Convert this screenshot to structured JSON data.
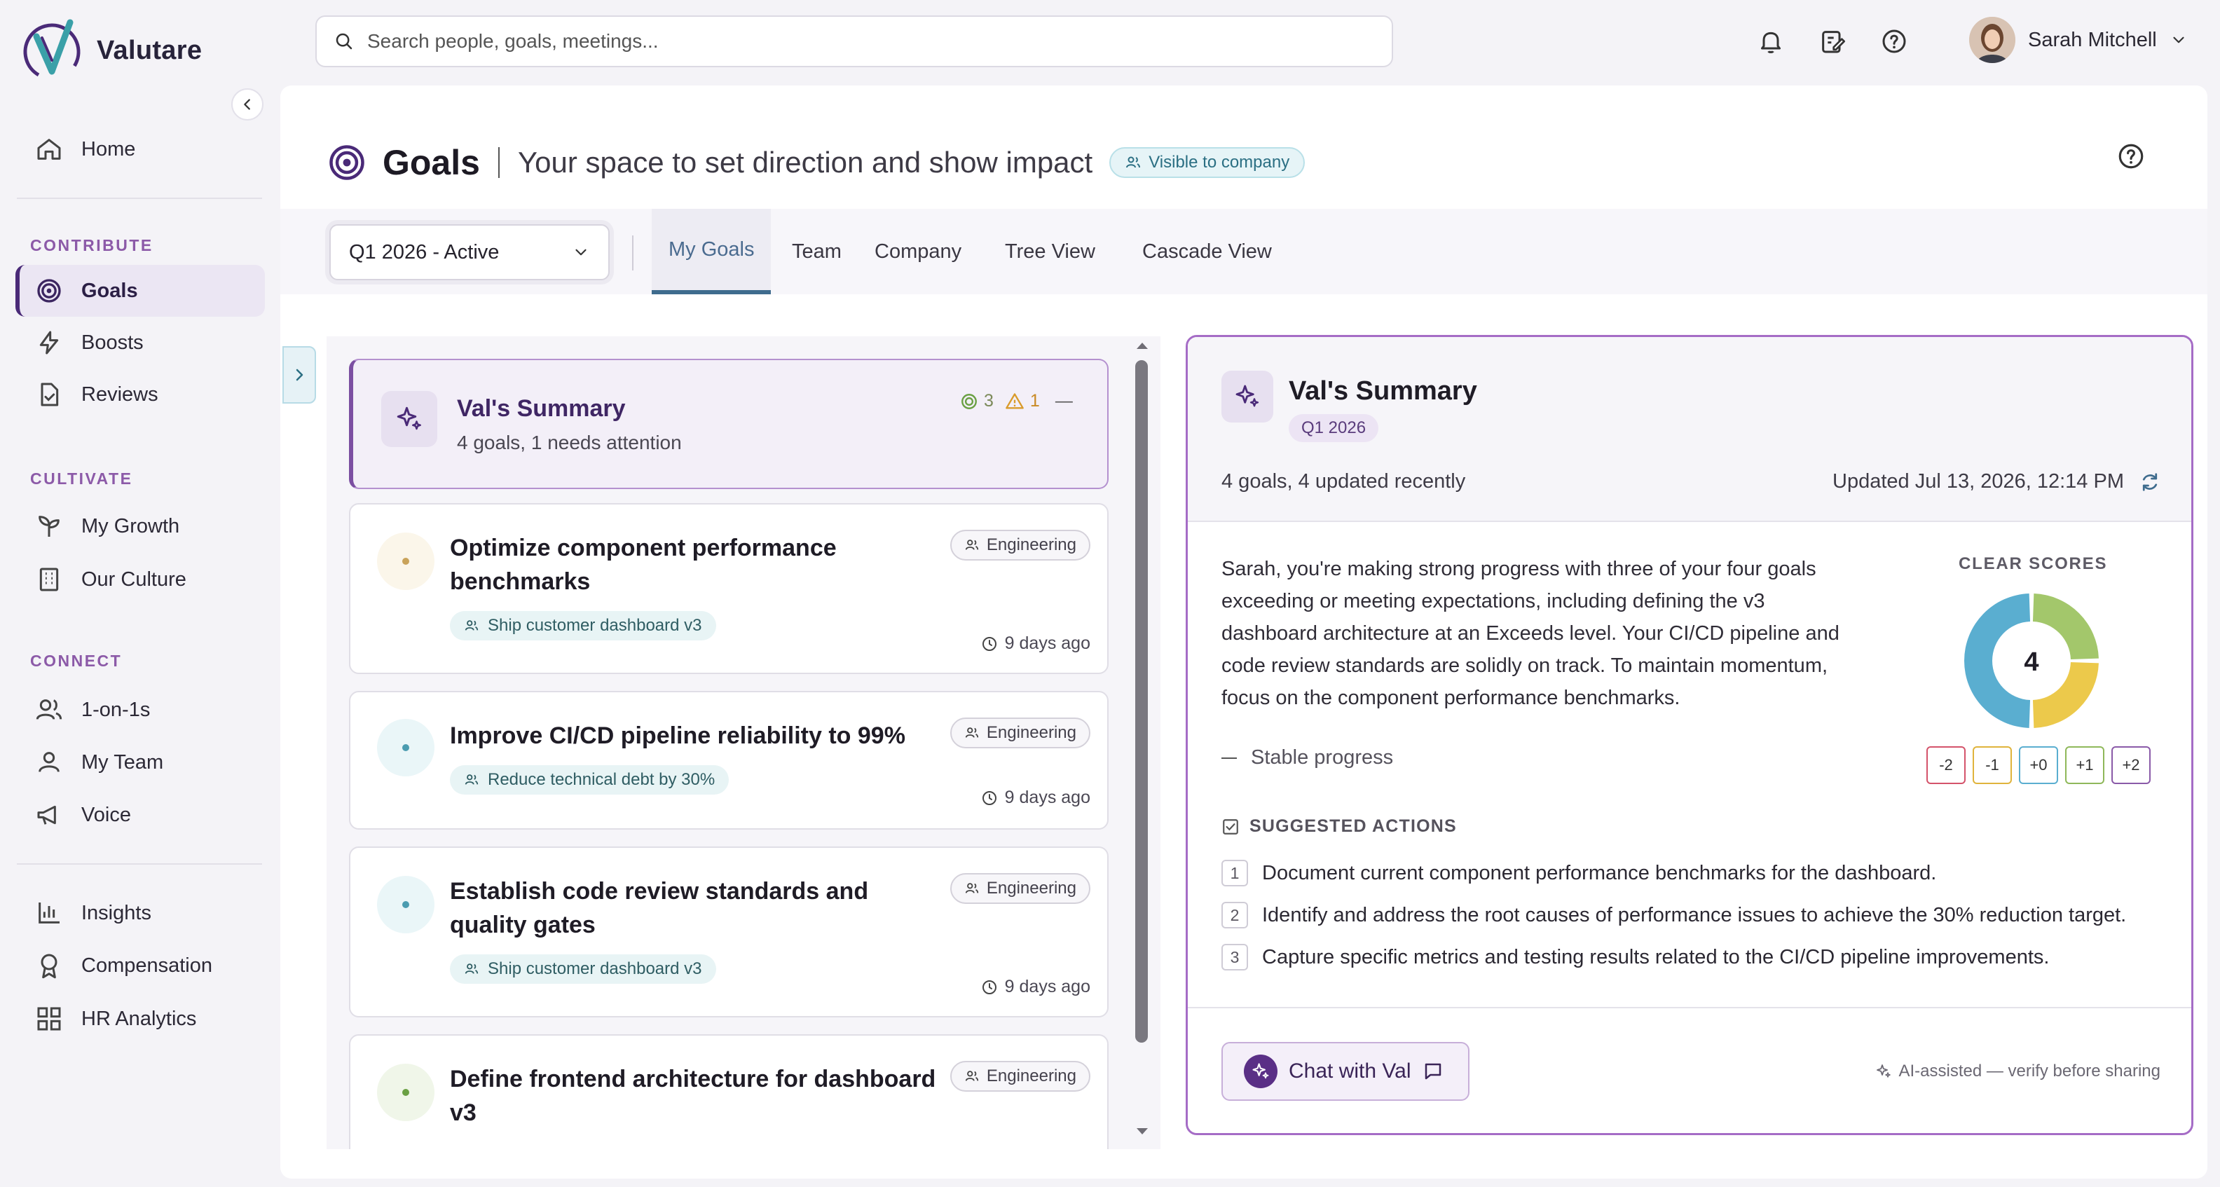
{
  "brand": {
    "name": "Valutare",
    "accent": "#4a2a78"
  },
  "sidebar": {
    "items_main": [
      {
        "label": "Home",
        "icon": "home-icon"
      }
    ],
    "sections": [
      {
        "label": "CONTRIBUTE",
        "items": [
          {
            "label": "Goals",
            "icon": "target-icon",
            "active": true
          },
          {
            "label": "Boosts",
            "icon": "lightning-icon"
          },
          {
            "label": "Reviews",
            "icon": "document-check-icon"
          }
        ]
      },
      {
        "label": "CULTIVATE",
        "items": [
          {
            "label": "My Growth",
            "icon": "sprout-icon"
          },
          {
            "label": "Our Culture",
            "icon": "building-icon"
          }
        ]
      },
      {
        "label": "CONNECT",
        "items": [
          {
            "label": "1-on-1s",
            "icon": "people-icon"
          },
          {
            "label": "My Team",
            "icon": "team-icon"
          },
          {
            "label": "Voice",
            "icon": "megaphone-icon"
          }
        ]
      }
    ],
    "items_bottom": [
      {
        "label": "Insights",
        "icon": "bar-chart-icon"
      },
      {
        "label": "Compensation",
        "icon": "award-icon"
      },
      {
        "label": "HR Analytics",
        "icon": "grid-icon"
      }
    ]
  },
  "topbar": {
    "search_placeholder": "Search people, goals, meetings...",
    "user_name": "Sarah Mitchell"
  },
  "page": {
    "title": "Goals",
    "subtitle": "Your space to set direction and show impact",
    "visibility": "Visible to company"
  },
  "toolbar": {
    "quarter": "Q1 2026 - Active",
    "tabs": [
      "My Goals",
      "Team",
      "Company",
      "Tree View",
      "Cascade View"
    ],
    "active_tab": "My Goals"
  },
  "summary_card": {
    "title": "Val's Summary",
    "subtitle": "4 goals, 1 needs attention",
    "on_track_count": "3",
    "warning_count": "1",
    "trend_symbol": "—"
  },
  "goals": [
    {
      "title": "Optimize component performance benchmarks",
      "dept": "Engineering",
      "parent": "Ship customer dashboard v3",
      "updated": "9 days ago",
      "status_color": "#c9a35a",
      "status_bg": "#fbf6ea"
    },
    {
      "title": "Improve CI/CD pipeline reliability to 99%",
      "dept": "Engineering",
      "parent": "Reduce technical debt by 30%",
      "updated": "9 days ago",
      "status_color": "#4b9cb0",
      "status_bg": "#eaf6f8"
    },
    {
      "title": "Establish code review standards and quality gates",
      "dept": "Engineering",
      "parent": "Ship customer dashboard v3",
      "updated": "9 days ago",
      "status_color": "#4b9cb0",
      "status_bg": "#eaf6f8"
    },
    {
      "title": "Define frontend architecture for dashboard v3",
      "dept": "Engineering",
      "parent": "",
      "updated": "",
      "status_color": "#6aa043",
      "status_bg": "#f0f6e9"
    }
  ],
  "detail": {
    "title": "Val's Summary",
    "quarter": "Q1 2026",
    "meta": "4 goals, 4 updated recently",
    "updated": "Updated Jul 13, 2026, 12:14 PM",
    "summary": "Sarah, you're making strong progress with three of your four goals exceeding or meeting expectations, including defining the v3 dashboard architecture at an Exceeds level. Your CI/CD pipeline and code review standards are solidly on track. To maintain momentum, focus on the component performance benchmarks.",
    "trend": "Stable progress",
    "clear_scores_label": "CLEAR SCORES",
    "clear_score": "4",
    "score_chips": [
      {
        "label": "-2",
        "color": "#d4536a"
      },
      {
        "label": "-1",
        "color": "#e0b43c"
      },
      {
        "label": "+0",
        "color": "#5aaed0"
      },
      {
        "label": "+1",
        "color": "#8fb85a"
      },
      {
        "label": "+2",
        "color": "#8a5aa8"
      }
    ],
    "donut_segments": [
      {
        "value": 1,
        "color": "#a3c76b"
      },
      {
        "value": 1,
        "color": "#ecc94b"
      },
      {
        "value": 2,
        "color": "#5aaed0"
      }
    ],
    "actions_label": "SUGGESTED ACTIONS",
    "actions": [
      "Document current component performance benchmarks for the dashboard.",
      "Identify and address the root causes of performance issues to achieve the 30% reduction target.",
      "Capture specific metrics and testing results related to the CI/CD pipeline improvements."
    ],
    "chat_label": "Chat with Val",
    "ai_note": "AI-assisted — verify before sharing"
  }
}
